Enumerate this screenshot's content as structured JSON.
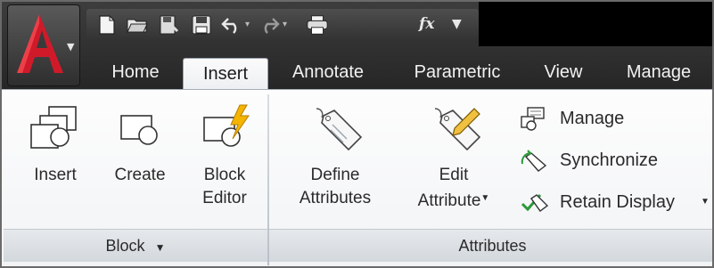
{
  "quick_access": {
    "icons": [
      "new-icon",
      "open-icon",
      "save-as-icon",
      "save-icon",
      "undo-icon",
      "redo-icon",
      "plot-icon",
      "function-icon",
      "customize-icon"
    ],
    "fx_label": "fx"
  },
  "tabs": [
    {
      "label": "Home",
      "active": false
    },
    {
      "label": "Insert",
      "active": true
    },
    {
      "label": "Annotate",
      "active": false
    },
    {
      "label": "Parametric",
      "active": false
    },
    {
      "label": "View",
      "active": false
    },
    {
      "label": "Manage",
      "active": false
    }
  ],
  "panels": {
    "block": {
      "title": "Block",
      "buttons": [
        {
          "line1": "Insert",
          "line2": ""
        },
        {
          "line1": "Create",
          "line2": ""
        },
        {
          "line1": "Block",
          "line2": "Editor"
        }
      ]
    },
    "attributes": {
      "title": "Attributes",
      "buttons": [
        {
          "line1": "Define",
          "line2": "Attributes"
        },
        {
          "line1": "Edit",
          "line2": "Attribute"
        }
      ],
      "small_buttons": [
        {
          "label": "Manage"
        },
        {
          "label": "Synchronize"
        },
        {
          "label": "Retain Display"
        }
      ]
    }
  },
  "colors": {
    "title_bar": "#2e2e2e",
    "ribbon_bg": "#f3f5f7",
    "accent_red": "#c8102e",
    "lightning": "#f5b400"
  }
}
